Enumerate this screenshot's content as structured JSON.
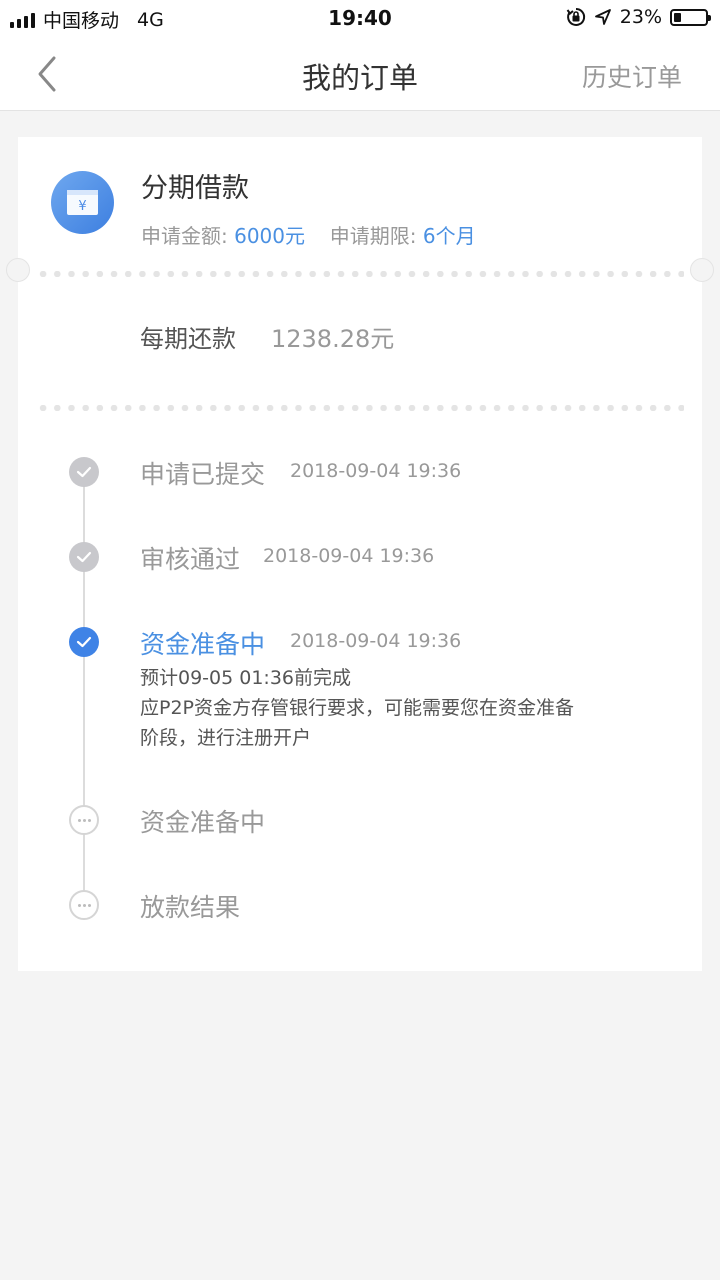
{
  "status_bar": {
    "carrier": "中国移动",
    "network": "4G",
    "time": "19:40",
    "battery": "23%",
    "battery_level": 0.23
  },
  "navbar": {
    "title": "我的订单",
    "history_label": "历史订单",
    "back_icon": "chevron-left-icon"
  },
  "loan": {
    "title": "分期借款",
    "amount_label": "申请金额: ",
    "amount_value": "6000元",
    "term_label": "申请期限: ",
    "term_value": "6个月",
    "icon": "wallet-yen-icon"
  },
  "repayment": {
    "label": "每期还款",
    "value": "1238.28元"
  },
  "timeline": [
    {
      "title": "申请已提交",
      "time": "2018-09-04 19:36",
      "state": "done"
    },
    {
      "title": "审核通过",
      "time": "2018-09-04 19:36",
      "state": "done"
    },
    {
      "title": "资金准备中",
      "time": "2018-09-04 19:36",
      "state": "active",
      "desc_line1": "预计09-05 01:36前完成",
      "desc_line2": "应P2P资金方存管银行要求，可能需要您在资金准备",
      "desc_line3": "阶段，进行注册开户"
    },
    {
      "title": "资金准备中",
      "state": "pending"
    },
    {
      "title": "放款结果",
      "state": "pending"
    }
  ],
  "colors": {
    "accent": "#4a90e2",
    "done_node": "#c8c8cc",
    "background": "#f4f4f4"
  }
}
